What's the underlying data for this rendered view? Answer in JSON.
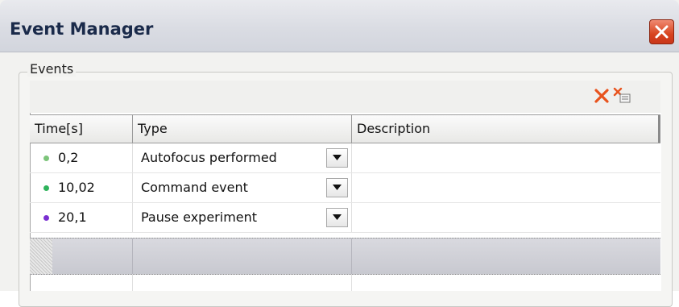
{
  "window": {
    "title": "Event Manager",
    "close_icon": "close-icon",
    "accent_close": "#d8441f"
  },
  "events_group": {
    "legend": "Events",
    "toolbar": {
      "delete_icon": "delete-icon",
      "delete_all_icon": "delete-all-icon",
      "delete_color": "#e8531d"
    }
  },
  "table": {
    "columns": [
      "Time[s]",
      "Type",
      "Description"
    ],
    "rows": [
      {
        "time": "0,2",
        "type": "Autofocus performed",
        "description": "",
        "dot_color": "#7cc47a"
      },
      {
        "time": "10,02",
        "type": "Command event",
        "description": "",
        "dot_color": "#2fb35c"
      },
      {
        "time": "20,1",
        "type": "Pause experiment",
        "description": "",
        "dot_color": "#7a2fd1"
      }
    ]
  }
}
